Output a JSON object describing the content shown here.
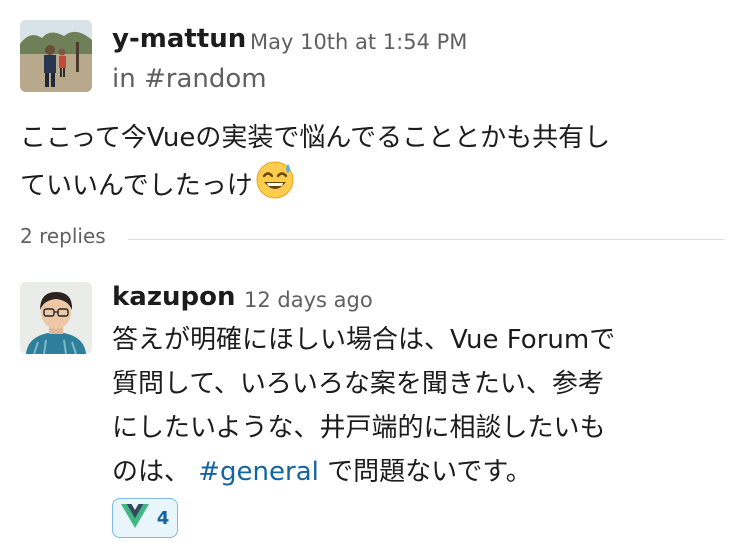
{
  "parent_message": {
    "author": "y-mattun",
    "timestamp": "May 10th at 1:54 PM",
    "channel": "in #random",
    "text_line1": "ここって今Vueの実装で悩んでることとかも共有し",
    "text_line2": "ていいんでしたっけ",
    "emoji": "sweat-smile"
  },
  "thread": {
    "replies_label": "2 replies"
  },
  "reply": {
    "author": "kazupon",
    "timestamp": "12 days ago",
    "text_line1": "答えが明確にほしい場合は、Vue Forumで",
    "text_line2": "質問して、いろいろな案を聞きたい、参考",
    "text_line3": "にしたいような、井戸端的に相談したいも",
    "text_line4_before": "のは、 ",
    "channel_link": "#general",
    "text_line4_after": " で問題ないです。",
    "reaction": {
      "emoji": "vue-logo",
      "count": "4",
      "colors": {
        "vue_green": "#41b883",
        "vue_dark": "#35495e"
      }
    }
  }
}
